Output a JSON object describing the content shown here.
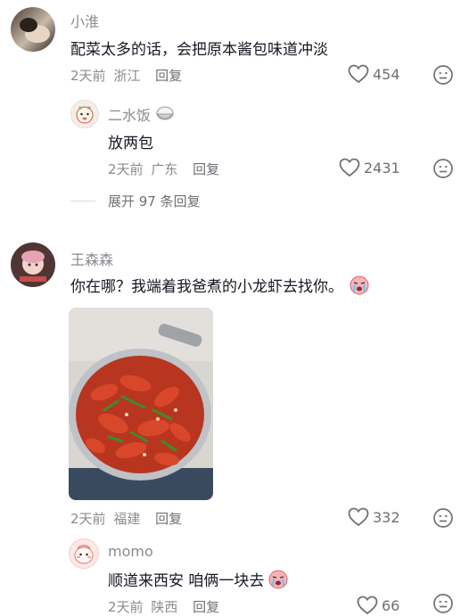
{
  "comments": [
    {
      "user": "小淮",
      "text": "配菜太多的话，会把原本酱包味道冲淡",
      "time": "2天前",
      "location": "浙江",
      "reply_label": "回复",
      "likes": "454",
      "replies": [
        {
          "user": "二水饭",
          "user_emoji": "rice-bowl-icon",
          "text": "放两包",
          "time": "2天前",
          "location": "广东",
          "reply_label": "回复",
          "likes": "2431"
        }
      ],
      "expand_label": "展开 97 条回复"
    },
    {
      "user": "王森森",
      "text": "你在哪？我端着我爸煮的小龙虾去找你。",
      "text_emoji": "crying-face-icon",
      "image": "crayfish-pot-photo",
      "time": "2天前",
      "location": "福建",
      "reply_label": "回复",
      "likes": "332",
      "replies": [
        {
          "user": "momo",
          "text": "顺道来西安 咱俩一块去",
          "text_emoji": "crying-face-icon",
          "time": "2天前",
          "location": "陕西",
          "reply_label": "回复",
          "likes": "66"
        }
      ]
    }
  ]
}
